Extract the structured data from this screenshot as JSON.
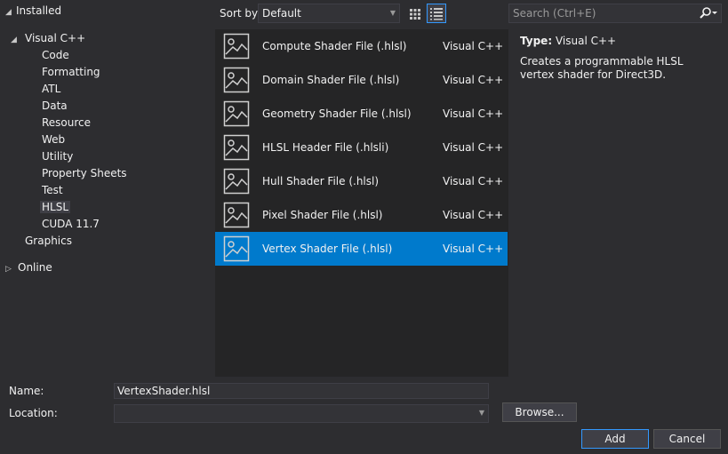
{
  "tree": {
    "installed": "Installed",
    "visual_cpp": "Visual C++",
    "children": [
      "Code",
      "Formatting",
      "ATL",
      "Data",
      "Resource",
      "Web",
      "Utility",
      "Property Sheets",
      "Test",
      "HLSL",
      "CUDA 11.7"
    ],
    "selected": "HLSL",
    "graphics": "Graphics",
    "online": "Online"
  },
  "toolbar": {
    "sort_label": "Sort by:",
    "sort_value": "Default",
    "search_placeholder": "Search (Ctrl+E)"
  },
  "templates": [
    {
      "name": "Compute Shader File (.hlsl)",
      "lang": "Visual C++"
    },
    {
      "name": "Domain Shader File (.hlsl)",
      "lang": "Visual C++"
    },
    {
      "name": "Geometry Shader File (.hlsl)",
      "lang": "Visual C++"
    },
    {
      "name": "HLSL Header File (.hlsli)",
      "lang": "Visual C++"
    },
    {
      "name": "Hull Shader File (.hlsl)",
      "lang": "Visual C++"
    },
    {
      "name": "Pixel Shader File (.hlsl)",
      "lang": "Visual C++"
    },
    {
      "name": "Vertex Shader File (.hlsl)",
      "lang": "Visual C++"
    }
  ],
  "selected_template": "Vertex Shader File (.hlsl)",
  "details": {
    "type_label": "Type:",
    "type_value": "Visual C++",
    "description": "Creates a programmable HLSL vertex shader for Direct3D."
  },
  "form": {
    "name_label": "Name:",
    "name_value": "VertexShader.hlsl",
    "location_label": "Location:",
    "location_value": "",
    "browse_label": "Browse...",
    "add_label": "Add",
    "cancel_label": "Cancel"
  },
  "colors": {
    "background": "#2d2d30",
    "list_background": "#252526",
    "selection": "#007acc",
    "text": "#f1f1f1"
  }
}
